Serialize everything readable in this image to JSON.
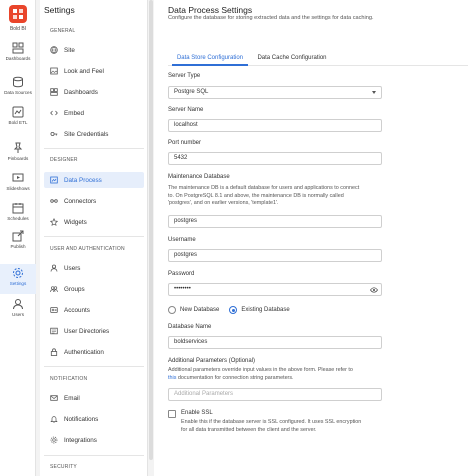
{
  "brand": {
    "name": "Bold BI",
    "color": "#e9452b"
  },
  "accent": "#2f6fd6",
  "rail": [
    {
      "id": "dashboards",
      "label": "Dashboards",
      "icon": "dashboards-icon"
    },
    {
      "id": "datasources",
      "label": "Data Sources",
      "icon": "data-sources-icon"
    },
    {
      "id": "boldetl",
      "label": "Bold ETL",
      "icon": "bold-etl-icon"
    },
    {
      "id": "pinboards",
      "label": "Pinboards",
      "icon": "pin-icon"
    },
    {
      "id": "slideshows",
      "label": "Slideshows",
      "icon": "slideshow-icon"
    },
    {
      "id": "schedules",
      "label": "Schedules",
      "icon": "calendar-icon"
    },
    {
      "id": "publish",
      "label": "Publish",
      "icon": "publish-icon"
    },
    {
      "id": "settings",
      "label": "Settings",
      "icon": "gear-icon",
      "active": true
    },
    {
      "id": "users",
      "label": "Users",
      "icon": "users-icon"
    }
  ],
  "settings_panel": {
    "title": "Settings",
    "sections": {
      "general": "GENERAL",
      "designer": "DESIGNER",
      "user_auth": "USER AND AUTHENTICATION",
      "notification": "NOTIFICATION",
      "security": "SECURITY"
    },
    "items": {
      "site": "Site",
      "look_and_feel": "Look and Feel",
      "dashboards": "Dashboards",
      "embed": "Embed",
      "site_credentials": "Site Credentials",
      "data_process": "Data Process",
      "connectors": "Connectors",
      "widgets": "Widgets",
      "users": "Users",
      "groups": "Groups",
      "accounts": "Accounts",
      "user_directories": "User Directories",
      "authentication": "Authentication",
      "email": "Email",
      "notifications": "Notifications",
      "integrations": "Integrations"
    }
  },
  "main": {
    "title": "Data Process Settings",
    "subtitle": "Configure the database for storing extracted data and the settings for data caching.",
    "tabs": {
      "store": "Data Store Configuration",
      "cache": "Data Cache Configuration"
    },
    "server_type": {
      "label": "Server Type",
      "value": "Postgre SQL"
    },
    "server_name": {
      "label": "Server Name",
      "value": "localhost"
    },
    "port": {
      "label": "Port number",
      "value": "5432"
    },
    "maintenance_db": {
      "label": "Maintenance Database",
      "help_1": "The maintenance DB is a default database for users and applications to connect",
      "help_2": "to. On PostgreSQL 8.1 and above, the maintenance DB is normally called",
      "help_3": "'postgres', and on earlier versions, 'template1'.",
      "value": "postgres"
    },
    "username": {
      "label": "Username",
      "value": "postgres"
    },
    "password": {
      "label": "Password",
      "value": "••••••••"
    },
    "db_choice": {
      "new": "New Database",
      "existing": "Existing Database"
    },
    "database_name": {
      "label": "Database Name",
      "value": "boldservices"
    },
    "additional": {
      "label": "Additional Parameters (Optional)",
      "help_1": "Additional parameters override input values in the above form. Please refer to",
      "help_link": "this",
      "help_2": " documentation for connection string parameters.",
      "placeholder": "Additional Parameters"
    },
    "ssl": {
      "label": "Enable SSL",
      "help_1": "Enable this if the database server is SSL configured. It uses SSL encryption",
      "help_2": "for all data transmitted between the client and the server."
    }
  }
}
